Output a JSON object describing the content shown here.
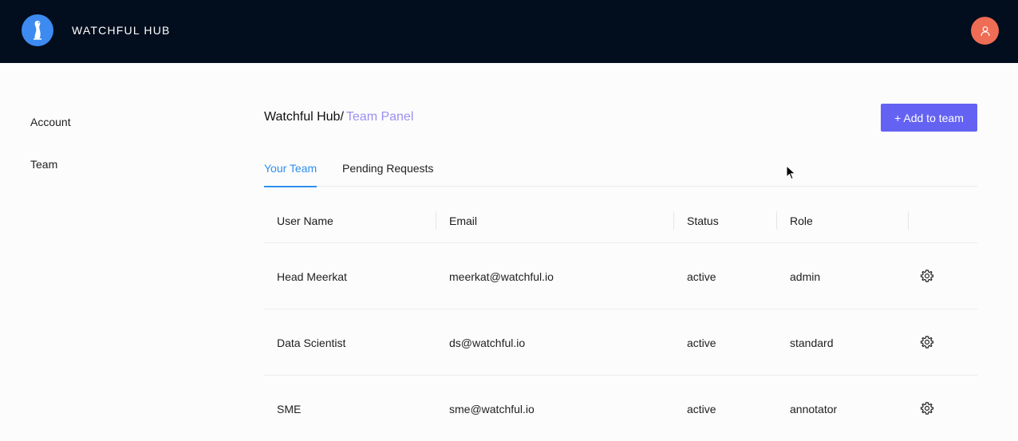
{
  "header": {
    "brand": "WATCHFUL HUB",
    "logo_icon": "meerkat-logo-icon",
    "avatar_icon": "user-icon",
    "colors": {
      "bar": "#020d1d",
      "logo": "#3d8bf0",
      "avatar": "#ef6c55"
    }
  },
  "sidebar": {
    "items": [
      {
        "label": "Account"
      },
      {
        "label": "Team"
      }
    ]
  },
  "breadcrumb": {
    "root": "Watchful Hub/",
    "current": "Team Panel"
  },
  "actions": {
    "add_label": "+ Add to team",
    "accent": "#6462f2"
  },
  "tabs": [
    {
      "label": "Your Team",
      "active": true
    },
    {
      "label": "Pending Requests",
      "active": false
    }
  ],
  "table": {
    "columns": [
      "User Name",
      "Email",
      "Status",
      "Role"
    ],
    "rows": [
      {
        "name": "Head Meerkat",
        "email": "meerkat@watchful.io",
        "status": "active",
        "role": "admin"
      },
      {
        "name": "Data Scientist",
        "email": "ds@watchful.io",
        "status": "active",
        "role": "standard"
      },
      {
        "name": "SME",
        "email": "sme@watchful.io",
        "status": "active",
        "role": "annotator"
      }
    ],
    "row_action_icon": "gear-icon"
  }
}
